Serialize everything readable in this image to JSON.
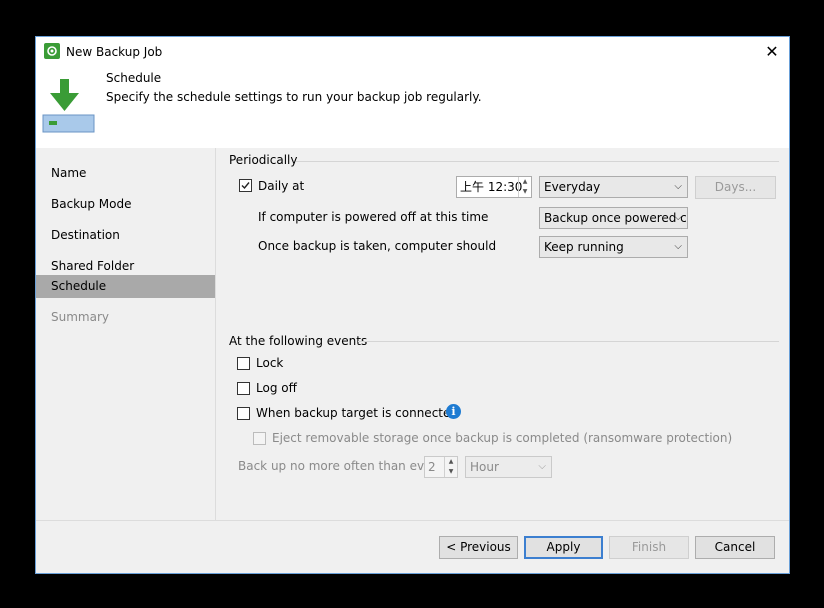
{
  "window": {
    "title": "New Backup Job",
    "close_glyph": "✕"
  },
  "header": {
    "title": "Schedule",
    "subtitle": "Specify the schedule settings to run your backup job regularly."
  },
  "sidebar": {
    "items": [
      {
        "label": "Name"
      },
      {
        "label": "Backup Mode"
      },
      {
        "label": "Destination"
      },
      {
        "label": "Shared Folder"
      },
      {
        "label": "Schedule"
      },
      {
        "label": "Summary"
      }
    ]
  },
  "periodically": {
    "group_label": "Periodically",
    "daily_at_label": "Daily at",
    "daily_checked": true,
    "time_value": "上午 12:30",
    "frequency_value": "Everyday",
    "days_button": "Days...",
    "powered_off_label": "If computer is powered off at this time",
    "powered_off_value": "Backup once powered c",
    "after_backup_label": "Once backup is taken, computer should",
    "after_backup_value": "Keep running"
  },
  "events": {
    "group_label": "At the following events",
    "lock_label": "Lock",
    "logoff_label": "Log off",
    "target_connected_label": "When backup target is connected",
    "eject_label": "Eject removable storage once backup is completed (ransomware protection)",
    "no_more_often_label": "Back up no more often than every",
    "interval_value": "2",
    "interval_unit": "Hour"
  },
  "footer": {
    "previous": "< Previous",
    "apply": "Apply",
    "finish": "Finish",
    "cancel": "Cancel"
  },
  "colors": {
    "brand_green": "#3a9c36",
    "info_blue": "#1e7bd2",
    "selected_nav": "#a9a9a9"
  }
}
